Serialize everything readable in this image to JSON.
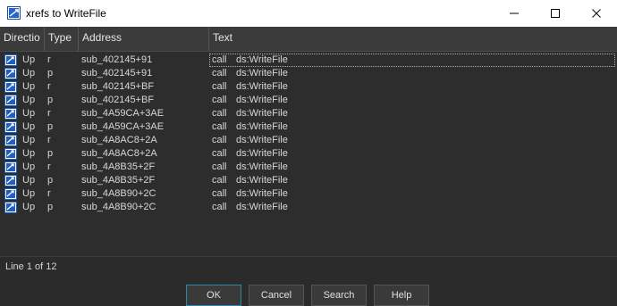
{
  "window": {
    "title": "xrefs to WriteFile",
    "icon": "ida-app-icon",
    "controls": [
      "minimize-icon",
      "maximize-icon",
      "close-icon"
    ]
  },
  "columns": {
    "direction": "Directio",
    "type": "Type",
    "address": "Address",
    "text": "Text"
  },
  "rows": [
    {
      "dir": "Up",
      "type": "r",
      "address": "sub_402145+91",
      "ins": "call",
      "operand": "ds:WriteFile"
    },
    {
      "dir": "Up",
      "type": "p",
      "address": "sub_402145+91",
      "ins": "call",
      "operand": "ds:WriteFile"
    },
    {
      "dir": "Up",
      "type": "r",
      "address": "sub_402145+BF",
      "ins": "call",
      "operand": "ds:WriteFile"
    },
    {
      "dir": "Up",
      "type": "p",
      "address": "sub_402145+BF",
      "ins": "call",
      "operand": "ds:WriteFile"
    },
    {
      "dir": "Up",
      "type": "r",
      "address": "sub_4A59CA+3AE",
      "ins": "call",
      "operand": "ds:WriteFile"
    },
    {
      "dir": "Up",
      "type": "p",
      "address": "sub_4A59CA+3AE",
      "ins": "call",
      "operand": "ds:WriteFile"
    },
    {
      "dir": "Up",
      "type": "r",
      "address": "sub_4A8AC8+2A",
      "ins": "call",
      "operand": "ds:WriteFile"
    },
    {
      "dir": "Up",
      "type": "p",
      "address": "sub_4A8AC8+2A",
      "ins": "call",
      "operand": "ds:WriteFile"
    },
    {
      "dir": "Up",
      "type": "r",
      "address": "sub_4A8B35+2F",
      "ins": "call",
      "operand": "ds:WriteFile"
    },
    {
      "dir": "Up",
      "type": "p",
      "address": "sub_4A8B35+2F",
      "ins": "call",
      "operand": "ds:WriteFile"
    },
    {
      "dir": "Up",
      "type": "r",
      "address": "sub_4A8B90+2C",
      "ins": "call",
      "operand": "ds:WriteFile"
    },
    {
      "dir": "Up",
      "type": "p",
      "address": "sub_4A8B90+2C",
      "ins": "call",
      "operand": "ds:WriteFile"
    }
  ],
  "selected_row": 0,
  "status": "Line 1 of 12",
  "buttons": {
    "ok": "OK",
    "cancel": "Cancel",
    "search": "Search",
    "help": "Help"
  },
  "colors": {
    "background": "#2b2b2b",
    "header": "#3b3b3b",
    "ok_border": "#2a8aa8",
    "xref_icon_blue": "#1f5fbf"
  }
}
